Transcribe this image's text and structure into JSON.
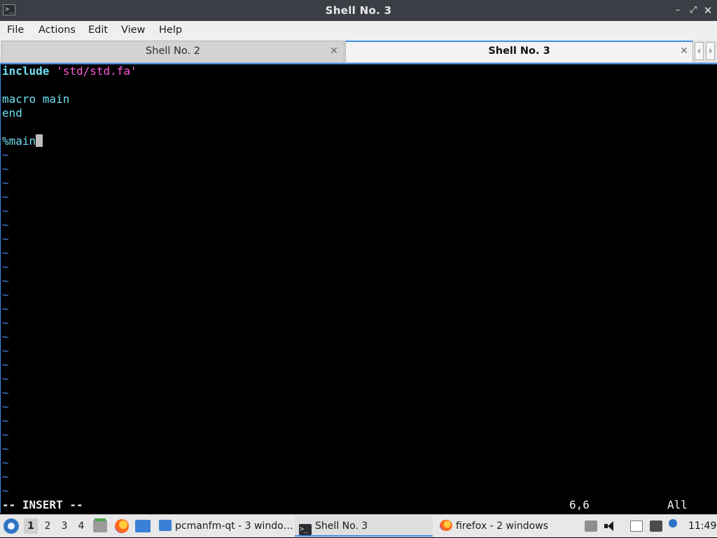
{
  "window": {
    "title": "Shell No. 3",
    "app_icon": ">_",
    "controls": {
      "minimize": "–",
      "maximize": "⤢",
      "close": "✕"
    }
  },
  "menu": {
    "items": [
      "File",
      "Actions",
      "Edit",
      "View",
      "Help"
    ]
  },
  "tabs": [
    {
      "label": "Shell No. 2",
      "active": false
    },
    {
      "label": "Shell No. 3",
      "active": true
    }
  ],
  "tab_controls": {
    "close": "✕",
    "scroll_left": "‹",
    "scroll_right": "›"
  },
  "editor": {
    "line1_keyword": "include",
    "line1_string": "'std/std.fa'",
    "line3": "macro main",
    "line4": "end",
    "line6": "%main",
    "tilde": "~",
    "mode": "-- INSERT --",
    "cursor_position": "6,6",
    "scroll_percent": "All"
  },
  "taskbar": {
    "workspaces": [
      "1",
      "2",
      "3",
      "4"
    ],
    "active_workspace": "1",
    "tasks": [
      {
        "label": "pcmanfm-qt - 3 windo…"
      },
      {
        "label": "Shell No. 3",
        "active": true
      },
      {
        "label": "firefox - 2 windows"
      }
    ],
    "clock": "11:49"
  },
  "colors": {
    "accent": "#3d8ee6",
    "keyword": "#6edff2",
    "string": "#ff5ad9",
    "tilde": "#4a7bd8"
  }
}
